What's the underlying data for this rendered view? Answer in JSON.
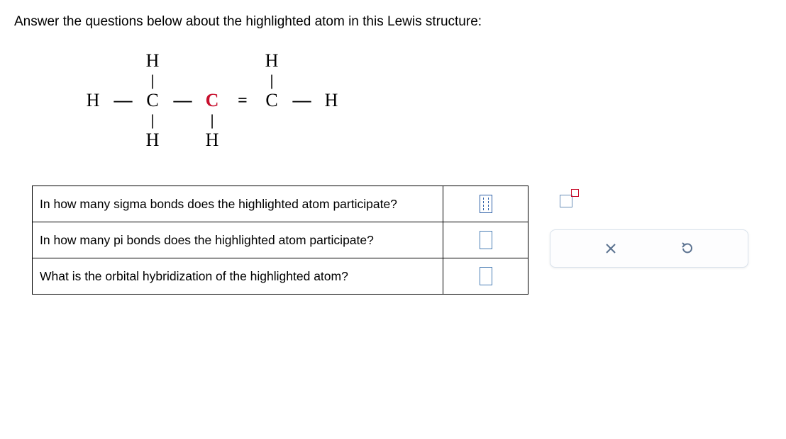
{
  "instruction": "Answer the questions below about the highlighted atom in this Lewis structure:",
  "lewis": {
    "atoms": {
      "H": "H",
      "C": "C",
      "C_hl": "C"
    },
    "bonds": {
      "single_h": "—",
      "single_v": "|",
      "double_h": "="
    }
  },
  "questions": [
    {
      "prompt": "In how many sigma bonds does the highlighted atom participate?"
    },
    {
      "prompt": "In how many pi bonds does the highlighted atom participate?"
    },
    {
      "prompt": "What is the orbital hybridization of the highlighted atom?"
    }
  ],
  "tools": {
    "exponent": "exponent-tool",
    "close": "close",
    "reset": "reset"
  }
}
